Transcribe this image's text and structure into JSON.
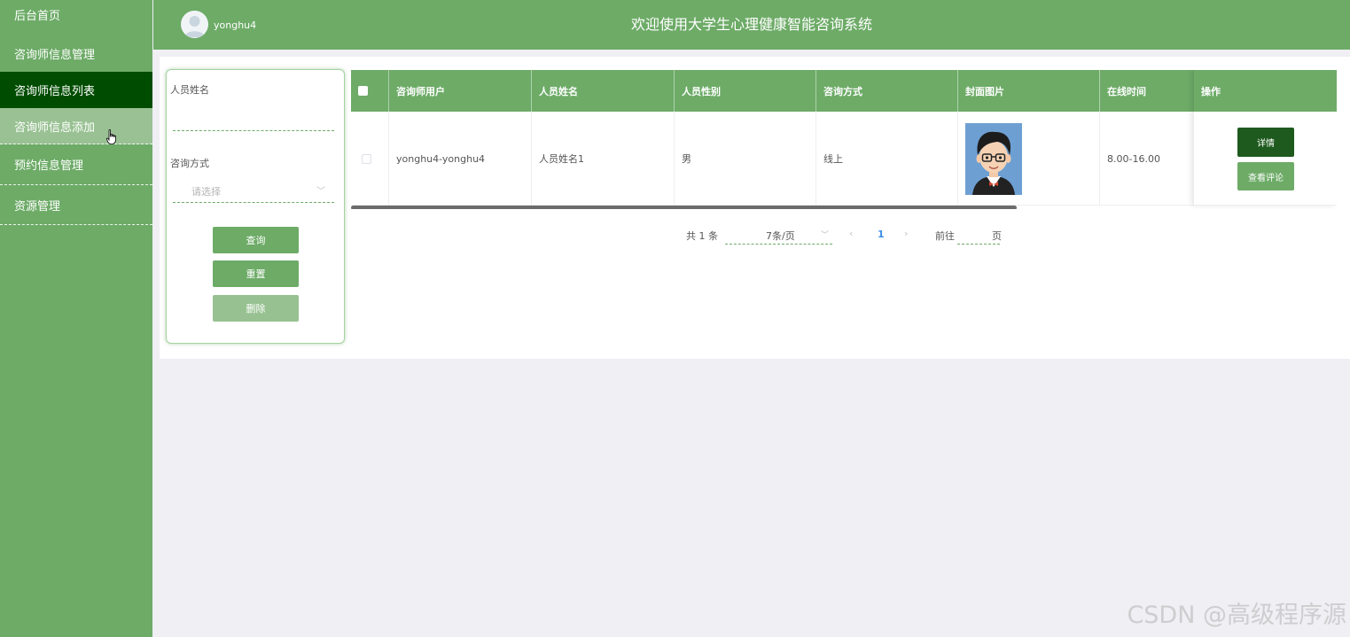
{
  "header": {
    "username": "yonghu4",
    "title": "欢迎使用大学生心理健康智能咨询系统"
  },
  "sidebar": {
    "items": [
      {
        "label": "后台首页"
      },
      {
        "label": "咨询师信息管理"
      },
      {
        "label": "咨询师信息列表"
      },
      {
        "label": "咨询师信息添加"
      },
      {
        "label": "预约信息管理"
      },
      {
        "label": "资源管理"
      }
    ]
  },
  "search": {
    "name_label": "人员姓名",
    "name_value": "",
    "mode_label": "咨询方式",
    "mode_placeholder": "请选择",
    "query_label": "查询",
    "reset_label": "重置",
    "delete_label": "删除"
  },
  "table": {
    "headers": [
      "咨询师用户",
      "人员姓名",
      "人员性别",
      "咨询方式",
      "封面图片",
      "在线时间",
      "操作"
    ],
    "rows": [
      {
        "user": "yonghu4-yonghu4",
        "name": "人员姓名1",
        "gender": "男",
        "mode": "线上",
        "online_time": "8.00-16.00",
        "detail_label": "详情",
        "comments_label": "查看评论"
      }
    ]
  },
  "pagination": {
    "total": "共 1 条",
    "page_size": "7条/页",
    "current_page": "1",
    "goto_label": "前往",
    "page_suffix": "页",
    "goto_value": ""
  },
  "watermark": "CSDN @高级程序源",
  "colors": {
    "primary": "#6dab67",
    "active_menu": "#004c00",
    "detail_button": "#1e5a1e"
  }
}
